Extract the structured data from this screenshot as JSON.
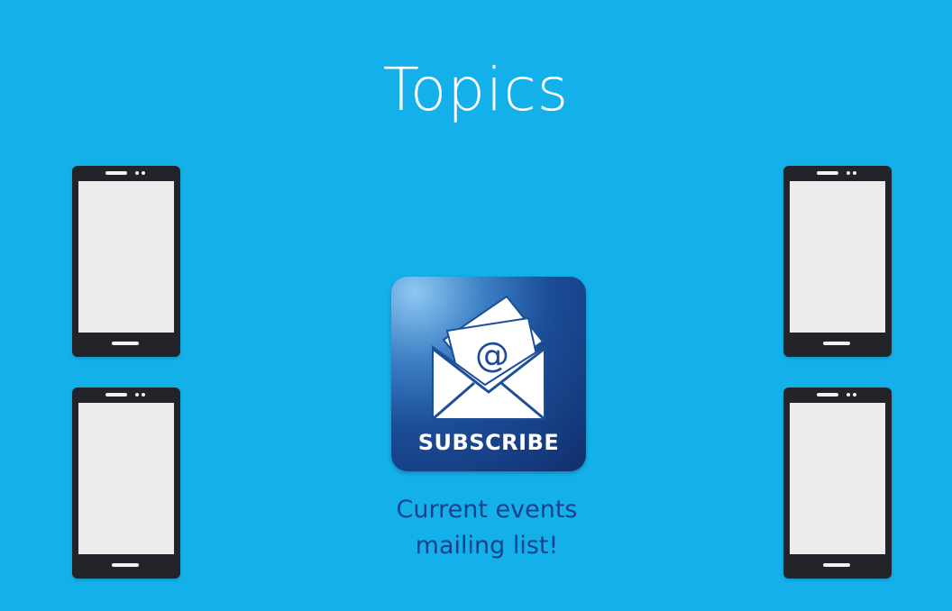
{
  "slide": {
    "title": "Topics",
    "badge": {
      "label": "SUBSCRIBE",
      "symbol": "@",
      "icon": "envelope-icon",
      "colors": {
        "dark": "#112f6e",
        "light": "#8ec8f2"
      }
    },
    "caption": {
      "line1": "Current events",
      "line2": "mailing list!"
    },
    "devices": [
      "phone-icon",
      "phone-icon",
      "phone-icon",
      "phone-icon"
    ],
    "colors": {
      "background": "#14b0ea",
      "title": "#ffffff",
      "caption": "#17418f",
      "phone_body": "#23232a",
      "phone_screen": "#ececec"
    }
  }
}
